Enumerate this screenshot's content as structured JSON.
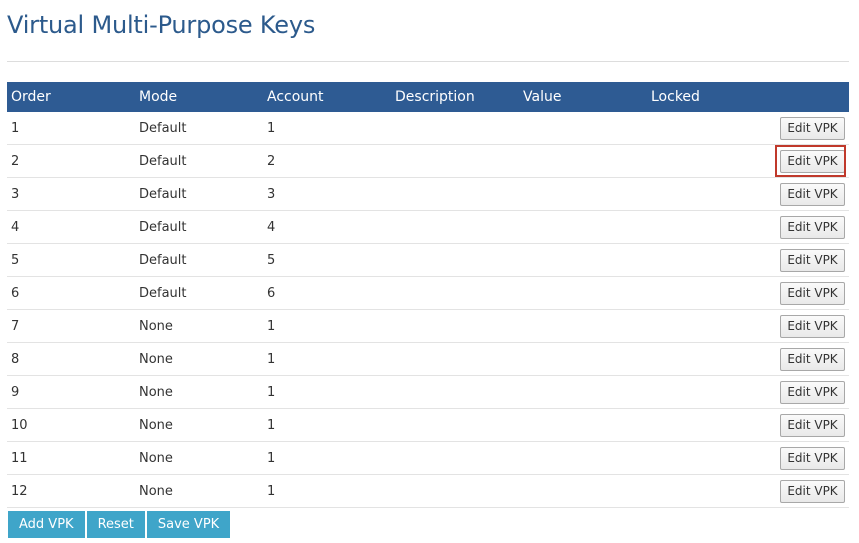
{
  "page": {
    "title": "Virtual Multi-Purpose Keys"
  },
  "table": {
    "headers": [
      "Order",
      "Mode",
      "Account",
      "Description",
      "Value",
      "Locked"
    ],
    "rows": [
      {
        "order": "1",
        "mode": "Default",
        "account": "1",
        "description": "",
        "value": "",
        "locked": "",
        "action": "Edit VPK"
      },
      {
        "order": "2",
        "mode": "Default",
        "account": "2",
        "description": "",
        "value": "",
        "locked": "",
        "action": "Edit VPK"
      },
      {
        "order": "3",
        "mode": "Default",
        "account": "3",
        "description": "",
        "value": "",
        "locked": "",
        "action": "Edit VPK"
      },
      {
        "order": "4",
        "mode": "Default",
        "account": "4",
        "description": "",
        "value": "",
        "locked": "",
        "action": "Edit VPK"
      },
      {
        "order": "5",
        "mode": "Default",
        "account": "5",
        "description": "",
        "value": "",
        "locked": "",
        "action": "Edit VPK"
      },
      {
        "order": "6",
        "mode": "Default",
        "account": "6",
        "description": "",
        "value": "",
        "locked": "",
        "action": "Edit VPK"
      },
      {
        "order": "7",
        "mode": "None",
        "account": "1",
        "description": "",
        "value": "",
        "locked": "",
        "action": "Edit VPK"
      },
      {
        "order": "8",
        "mode": "None",
        "account": "1",
        "description": "",
        "value": "",
        "locked": "",
        "action": "Edit VPK"
      },
      {
        "order": "9",
        "mode": "None",
        "account": "1",
        "description": "",
        "value": "",
        "locked": "",
        "action": "Edit VPK"
      },
      {
        "order": "10",
        "mode": "None",
        "account": "1",
        "description": "",
        "value": "",
        "locked": "",
        "action": "Edit VPK"
      },
      {
        "order": "11",
        "mode": "None",
        "account": "1",
        "description": "",
        "value": "",
        "locked": "",
        "action": "Edit VPK"
      },
      {
        "order": "12",
        "mode": "None",
        "account": "1",
        "description": "",
        "value": "",
        "locked": "",
        "action": "Edit VPK"
      }
    ]
  },
  "footer": {
    "add_label": "Add VPK",
    "reset_label": "Reset",
    "save_label": "Save VPK"
  },
  "colors": {
    "title": "#2c5a8c",
    "header_bg": "#2e5b93",
    "footer_button_bg": "#3fa5c9",
    "highlight": "#c0392b"
  }
}
